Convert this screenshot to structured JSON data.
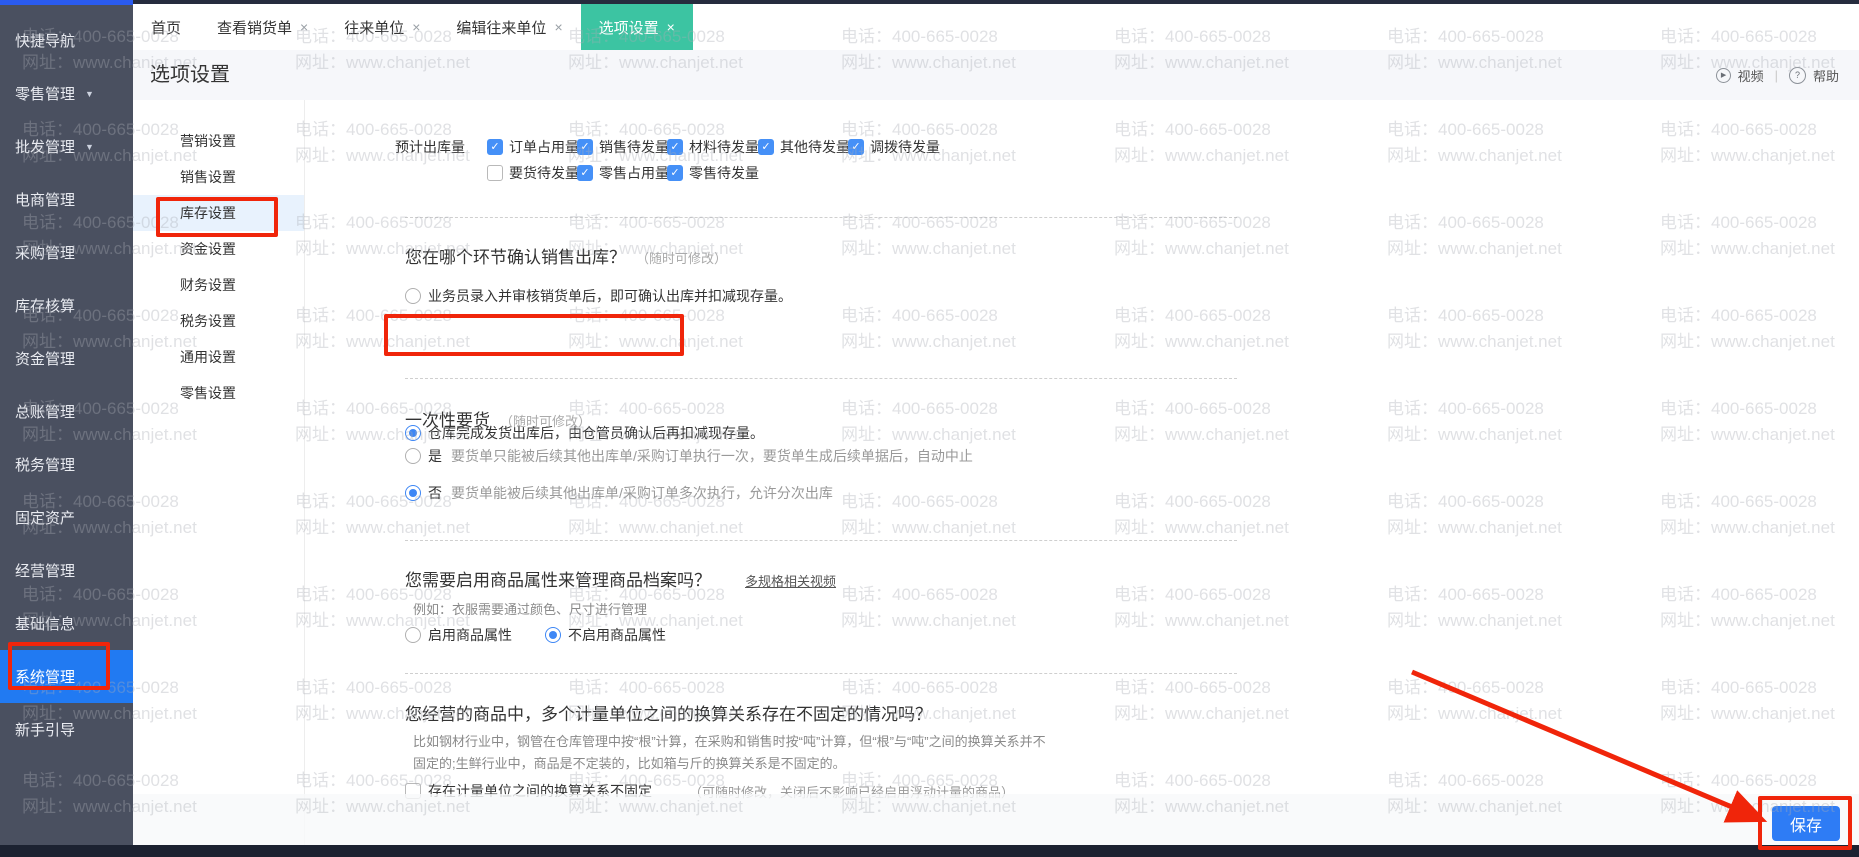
{
  "watermark": {
    "phone": "电话：400-665-0028",
    "site": "网址：www.chanjet.net"
  },
  "sidebar": {
    "items": [
      {
        "label": "快捷导航"
      },
      {
        "label": "零售管理",
        "arrow": "▼"
      },
      {
        "label": "批发管理",
        "arrow": "▼"
      },
      {
        "label": "电商管理"
      },
      {
        "label": "采购管理"
      },
      {
        "label": "库存核算"
      },
      {
        "label": "资金管理"
      },
      {
        "label": "总账管理"
      },
      {
        "label": "税务管理"
      },
      {
        "label": "固定资产"
      },
      {
        "label": "经营管理"
      },
      {
        "label": "基础信息"
      },
      {
        "label": "系统管理",
        "active": true
      },
      {
        "label": "新手引导"
      }
    ]
  },
  "tabs": [
    {
      "label": "首页",
      "closable": false,
      "active": false
    },
    {
      "label": "查看销货单",
      "closable": true,
      "active": false
    },
    {
      "label": "往来单位",
      "closable": true,
      "active": false
    },
    {
      "label": "编辑往来单位",
      "closable": true,
      "active": false
    },
    {
      "label": "选项设置",
      "closable": true,
      "active": true
    }
  ],
  "header": {
    "title": "选项设置",
    "video": "视频",
    "help": "帮助"
  },
  "settings_nav": [
    {
      "label": "营销设置"
    },
    {
      "label": "销售设置"
    },
    {
      "label": "库存设置",
      "active": true
    },
    {
      "label": "资金设置"
    },
    {
      "label": "财务设置"
    },
    {
      "label": "税务设置"
    },
    {
      "label": "通用设置"
    },
    {
      "label": "零售设置"
    }
  ],
  "inventory": {
    "estimate_label": "预计出库量",
    "estimate_row1": [
      {
        "label": "订单占用量",
        "checked": true
      },
      {
        "label": "销售待发量",
        "checked": true
      },
      {
        "label": "材料待发量",
        "checked": true
      },
      {
        "label": "其他待发量",
        "checked": true
      },
      {
        "label": "调拨待发量",
        "checked": true
      }
    ],
    "estimate_row2": [
      {
        "label": "要货待发量",
        "checked": false
      },
      {
        "label": "零售占用量",
        "checked": true
      },
      {
        "label": "零售待发量",
        "checked": true
      }
    ],
    "sections": {
      "sales_outbound": {
        "title": "您在哪个环节确认销售出库？",
        "note": "（随时可修改）",
        "option1": {
          "label": "业务员录入并审核销货单后，即可确认出库并扣减现存量。",
          "selected": false
        },
        "option2": {
          "label": "仓库完成发货出库后，由仓管员确认后再扣减现存量。",
          "selected": true
        }
      },
      "one_time_request": {
        "title": "一次性要货",
        "note": "（随时可修改）",
        "option1": {
          "label": "是",
          "desc": "要货单只能被后续其他出库单/采购订单执行一次，要货单生成后续单据后，自动中止",
          "selected": false
        },
        "option2": {
          "label": "否",
          "desc": "要货单能被后续其他出库单/采购订单多次执行，允许分次出库",
          "selected": true
        }
      },
      "product_attr": {
        "title": "您需要启用商品属性来管理商品档案吗？",
        "link": "多规格相关视频",
        "subtitle": "例如：衣服需要通过颜色、尺寸进行管理",
        "option1": {
          "label": "启用商品属性",
          "selected": false
        },
        "option2": {
          "label": "不启用商品属性",
          "selected": true
        }
      },
      "unit_conversion": {
        "title": "您经营的商品中，多个计量单位之间的换算关系存在不固定的情况吗？",
        "desc1": "比如钢材行业中，钢管在仓库管理中按“根”计算，在采购和销售时按“吨”计算，但“根”与“吨”之间的换算关系并不",
        "desc2": "固定的;生鲜行业中，商品是不定装的，比如箱与斤的换算关系是不固定的。",
        "option1": {
          "label": "存在计量单位之间的换算关系不固定",
          "note": "（可随时修改，关闭后不影响已经启用浮动计量的商品）",
          "checked": false
        }
      }
    }
  },
  "footer": {
    "save": "保存"
  }
}
